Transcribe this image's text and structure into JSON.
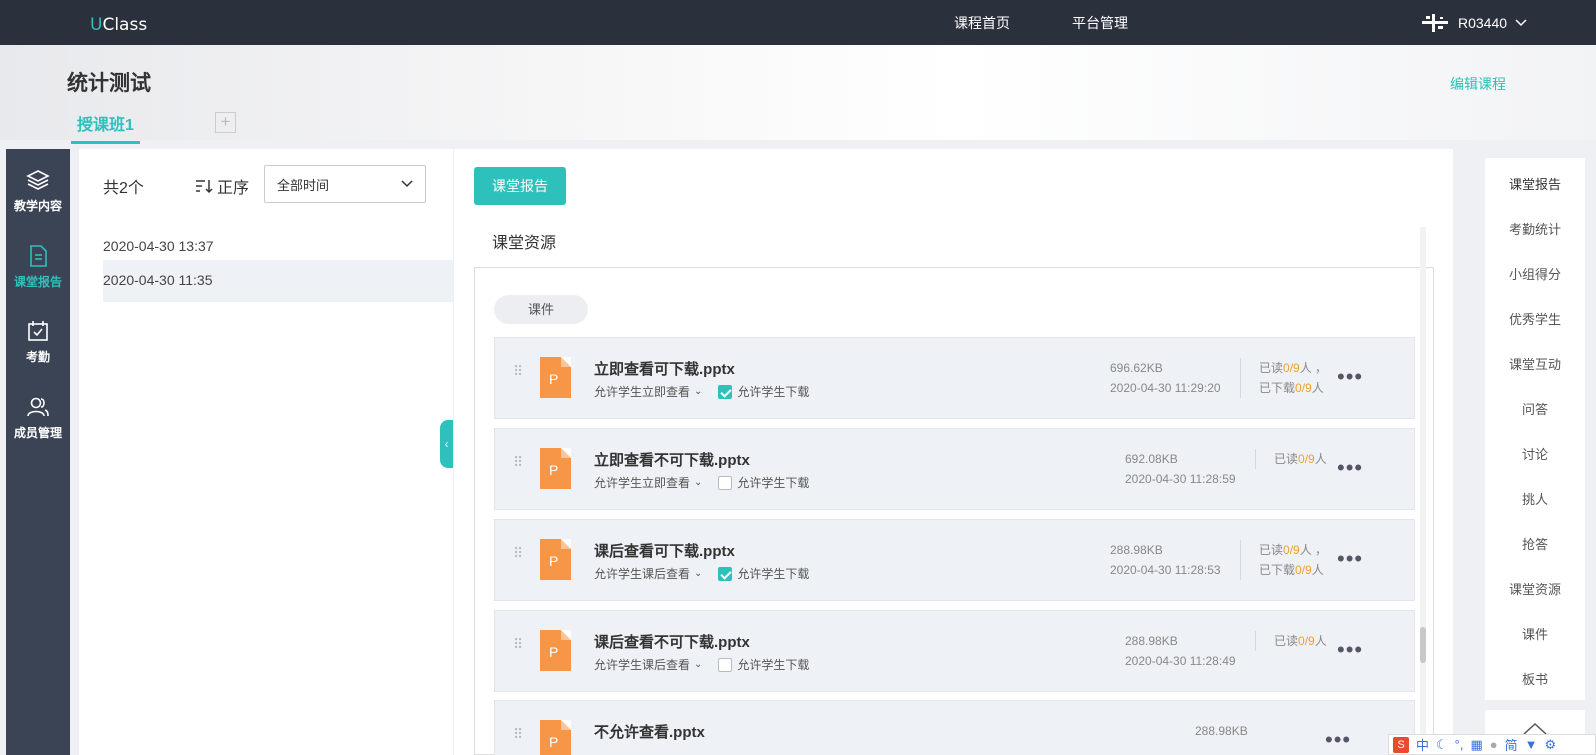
{
  "topbar": {
    "logo_u": "U",
    "logo_rest": "Class",
    "nav": [
      "课程首页",
      "平台管理"
    ],
    "user": "R03440"
  },
  "header": {
    "course_title": "统计测试",
    "edit_course": "编辑课程",
    "class_tab": "授课班1",
    "add_tab": "+"
  },
  "leftnav": {
    "items": [
      {
        "label": "教学内容",
        "icon": "layers-icon"
      },
      {
        "label": "课堂报告",
        "icon": "document-icon"
      },
      {
        "label": "考勤",
        "icon": "calendar-check-icon"
      },
      {
        "label": "成员管理",
        "icon": "users-icon"
      }
    ],
    "active_index": 1
  },
  "sessions": {
    "count_label": "共2个",
    "sort_label": "正序",
    "time_filter": "全部时间",
    "items": [
      "2020-04-30 13:37",
      "2020-04-30 11:35"
    ],
    "active_index": 1
  },
  "main": {
    "report_button": "课堂报告",
    "resources_title": "课堂资源",
    "tag": "课件",
    "files": [
      {
        "name": "立即查看可下载.pptx",
        "view": "允许学生立即查看",
        "download_label": "允许学生下载",
        "download": true,
        "size": "696.62KB",
        "time": "2020-04-30 11:29:20",
        "read_prefix": "已读",
        "read": "0/9",
        "read_suffix": "人 ，",
        "dl_prefix": "已下载",
        "dl": "0/9",
        "dl_suffix": "人"
      },
      {
        "name": "立即查看不可下载.pptx",
        "view": "允许学生立即查看",
        "download_label": "允许学生下载",
        "download": false,
        "size": "692.08KB",
        "time": "2020-04-30 11:28:59",
        "read_prefix": "已读",
        "read": "0/9",
        "read_suffix": "人"
      },
      {
        "name": "课后查看可下载.pptx",
        "view": "允许学生课后查看",
        "download_label": "允许学生下载",
        "download": true,
        "size": "288.98KB",
        "time": "2020-04-30 11:28:53",
        "read_prefix": "已读",
        "read": "0/9",
        "read_suffix": "人 ，",
        "dl_prefix": "已下载",
        "dl": "0/9",
        "dl_suffix": "人"
      },
      {
        "name": "课后查看不可下载.pptx",
        "view": "允许学生课后查看",
        "download_label": "允许学生下载",
        "download": false,
        "size": "288.98KB",
        "time": "2020-04-30 11:28:49",
        "read_prefix": "已读",
        "read": "0/9",
        "read_suffix": "人"
      },
      {
        "name": "不允许查看.pptx",
        "size": "288.98KB"
      }
    ]
  },
  "rightnav": {
    "items": [
      "课堂报告",
      "考勤统计",
      "小组得分",
      "优秀学生",
      "课堂互动",
      "问答",
      "讨论",
      "挑人",
      "抢答",
      "课堂资源",
      "课件",
      "板书"
    ]
  },
  "ime": {
    "logo": "S",
    "mode": "中",
    "simplified": "简"
  },
  "colors": {
    "accent": "#2ec0bb",
    "topbar": "#2b313c",
    "sidebar": "#3b4455",
    "highlight": "#f0a030",
    "ppt": "#f79646"
  }
}
